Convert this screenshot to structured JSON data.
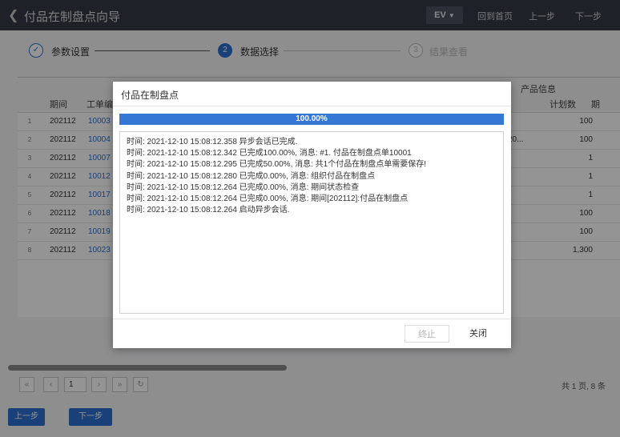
{
  "header": {
    "back_icon": "chevron-left-icon",
    "title": "付品在制盘点向导",
    "ev_label": "EV",
    "home": "回到首页",
    "prev": "上一步",
    "next": "下一步"
  },
  "steps": [
    {
      "label": "参数设置",
      "state": "done"
    },
    {
      "label": "数据选择",
      "number": "2",
      "state": "active"
    },
    {
      "label": "结果查看",
      "number": "3",
      "state": "pending"
    }
  ],
  "grid": {
    "group_header": "产品信息",
    "columns": {
      "period": "期间",
      "doc": "工单编",
      "plan": "计划数",
      "extra": "期",
      "plan_partial": "20..."
    },
    "rows": [
      {
        "idx": "1",
        "period": "202112",
        "doc": "10003",
        "plan": "100"
      },
      {
        "idx": "2",
        "period": "202112",
        "doc": "10004",
        "plan": "100"
      },
      {
        "idx": "3",
        "period": "202112",
        "doc": "10007",
        "plan": "1"
      },
      {
        "idx": "4",
        "period": "202112",
        "doc": "10012",
        "plan": "1"
      },
      {
        "idx": "5",
        "period": "202112",
        "doc": "10017",
        "plan": "1"
      },
      {
        "idx": "6",
        "period": "202112",
        "doc": "10018",
        "plan": "100"
      },
      {
        "idx": "7",
        "period": "202112",
        "doc": "10019",
        "plan": "100"
      },
      {
        "idx": "8",
        "period": "202112",
        "doc": "10023",
        "plan": "1,300"
      }
    ]
  },
  "pager": {
    "page": "1",
    "total": "共 1 页, 8 条"
  },
  "bottom": {
    "prev": "上一步",
    "next": "下一步"
  },
  "dialog": {
    "title": "付品在制盘点",
    "progress": 100,
    "progress_text": "100.00%",
    "logs": [
      "时间: 2021-12-10 15:08:12.358 异步会话已完成.",
      "时间: 2021-12-10 15:08:12.342 已完成100.00%, 消息: #1. 付品在制盘点单10001",
      "时间: 2021-12-10 15:08:12.295 已完成50.00%, 消息: 共1个付品在制盘点单需要保存!",
      "时间: 2021-12-10 15:08:12.280 已完成0.00%, 消息: 组织付品在制盘点",
      "时间: 2021-12-10 15:08:12.264 已完成0.00%, 消息: 期间状态检查",
      "时间: 2021-12-10 15:08:12.264 已完成0.00%, 消息: 期间[202112]:付品在制盘点",
      "时间: 2021-12-10 15:08:12.264 启动异步会话."
    ],
    "stop_label": "终止",
    "close_label": "关闭"
  }
}
